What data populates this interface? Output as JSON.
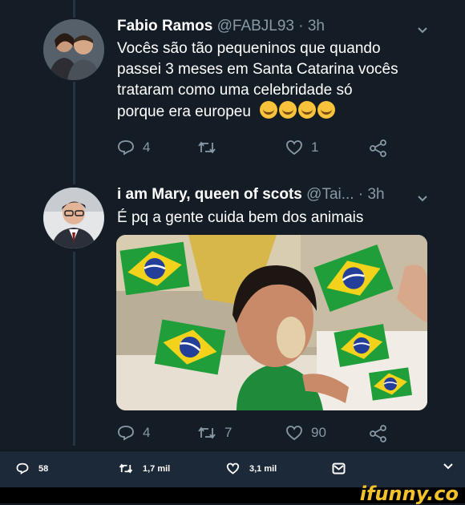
{
  "tweet1": {
    "name": "Fabio Ramos",
    "handle": "@FABJL93 · 3h",
    "lines": [
      "Vocês são tão pequeninos que quando",
      "passei 3 meses em Santa Catarina vocês",
      "trataram como uma celebridade só",
      "porque era europeu"
    ],
    "emoji_icon": "joy-emoji-icon",
    "emoji_count": 4,
    "replies": "4",
    "retweets": "",
    "likes": "1"
  },
  "tweet2": {
    "name": "i am Mary, queen of scots",
    "handle": "@Tai... · 3h",
    "text": "É pq a gente cuida bem dos animais",
    "replies": "4",
    "retweets": "7",
    "likes": "90"
  },
  "bottom_bar": {
    "replies": "58",
    "retweets": "1,7 mil",
    "likes": "3,1 mil"
  },
  "watermark": "ifunny.co",
  "colors": {
    "background": "#141d26",
    "secondary_text": "#8899a6",
    "flag_green": "#1f9e3a",
    "flag_yellow": "#f2d21a",
    "flag_blue": "#243f9a",
    "watermark_yellow": "#f3c22b"
  }
}
